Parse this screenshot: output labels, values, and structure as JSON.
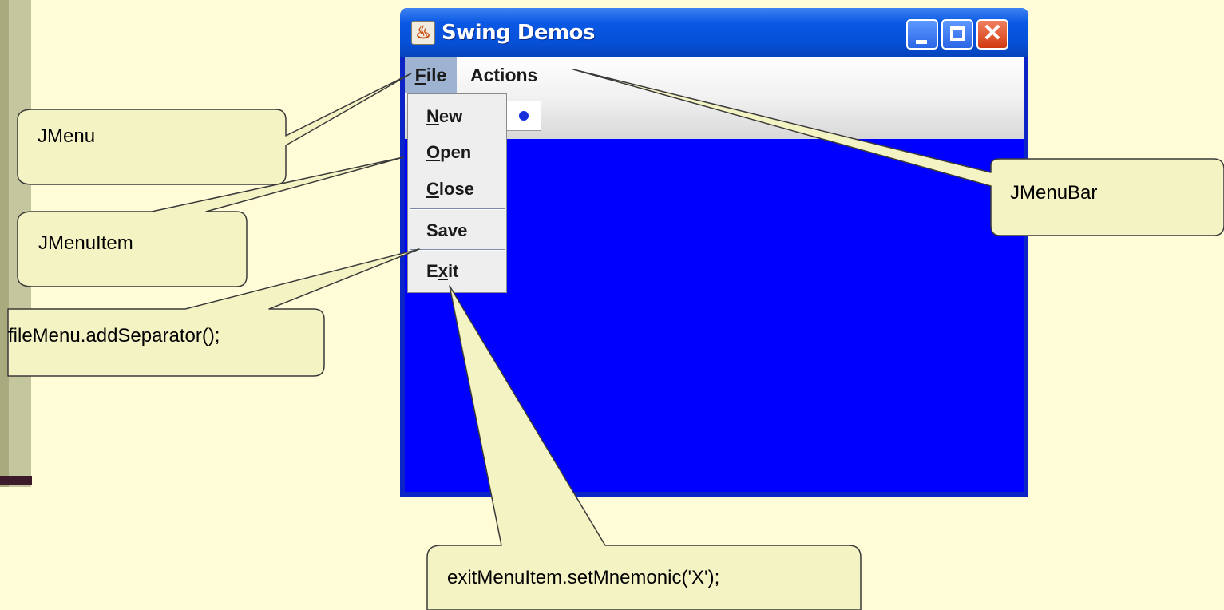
{
  "window": {
    "title": "Swing Demos",
    "controls": {
      "minimize": "minimize",
      "maximize": "maximize",
      "close": "✕"
    }
  },
  "menubar": {
    "file": {
      "mnemonic": "F",
      "rest": "ile"
    },
    "actions": "Actions"
  },
  "file_menu": {
    "items": [
      {
        "mnemonic": "N",
        "rest": "ew"
      },
      {
        "mnemonic": "O",
        "rest": "pen"
      },
      {
        "mnemonic": "C",
        "rest": "lose"
      },
      {
        "pre": "Save"
      },
      {
        "pre": "E",
        "mnemonic": "x",
        "rest": "it"
      }
    ]
  },
  "callouts": {
    "jmenu": "JMenu",
    "jmenuitem": "JMenuItem",
    "separator": "fileMenu.addSeparator();",
    "jmenubar": "JMenuBar",
    "mnemonic": "exitMenuItem.setMnemonic('X');"
  },
  "colors": {
    "slide_bg": "#fffcd7",
    "window_content": "#0000ff",
    "callout_fill": "#f4f3c4"
  }
}
